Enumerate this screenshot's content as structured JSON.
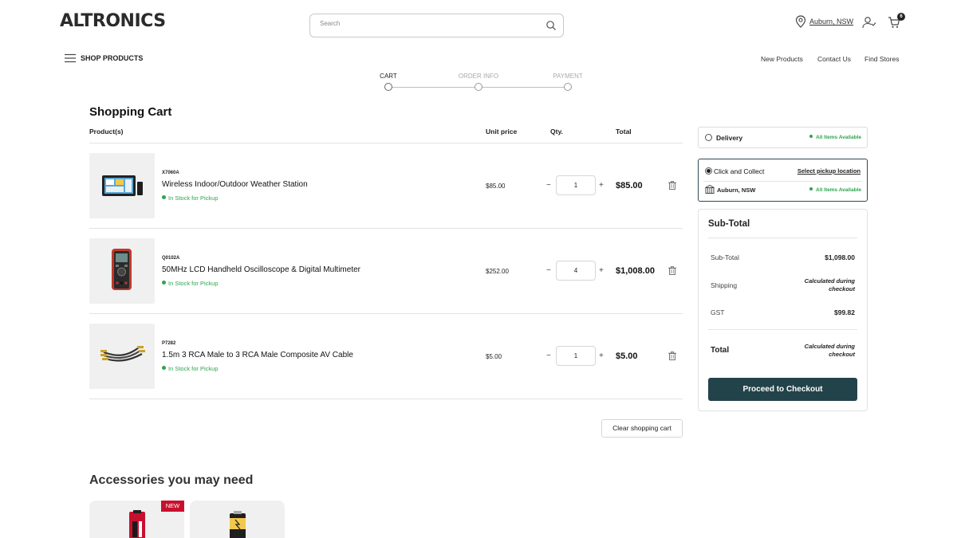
{
  "header": {
    "logo_text": "ALTRONICS",
    "search_placeholder": "Search",
    "location": "Auburn, NSW",
    "cart_count": "6",
    "shop_products": "SHOP PRODUCTS",
    "nav": [
      "New Products",
      "Contact Us",
      "Find Stores"
    ]
  },
  "steps": [
    {
      "label": "CART",
      "active": true
    },
    {
      "label": "ORDER INFO",
      "active": false
    },
    {
      "label": "PAYMENT",
      "active": false
    }
  ],
  "cart": {
    "title": "Shopping Cart",
    "columns": {
      "product": "Product(s)",
      "unit_price": "Unit price",
      "qty": "Qty.",
      "total": "Total"
    },
    "items": [
      {
        "sku": "X7060A",
        "name": "Wireless Indoor/Outdoor Weather Station",
        "stock": "In Stock for Pickup",
        "unit_price": "$85.00",
        "qty": "1",
        "total": "$85.00",
        "icon": "weather-station-image"
      },
      {
        "sku": "Q0102A",
        "name": "50MHz LCD Handheld Oscilloscope & Digital Multimeter",
        "stock": "In Stock for Pickup",
        "unit_price": "$252.00",
        "qty": "4",
        "total": "$1,008.00",
        "icon": "oscilloscope-image"
      },
      {
        "sku": "P7282",
        "name": "1.5m 3 RCA Male to 3 RCA Male Composite AV Cable",
        "stock": "In Stock for Pickup",
        "unit_price": "$5.00",
        "qty": "1",
        "total": "$5.00",
        "icon": "rca-cable-image"
      }
    ],
    "minus_glyph": "−",
    "plus_glyph": "+",
    "clear_label": "Clear shopping cart"
  },
  "accessories": {
    "title": "Accessories you may need",
    "new_badge": "NEW"
  },
  "fulfilment": {
    "delivery": {
      "label": "Delivery",
      "availability": "All Items Available",
      "selected": false
    },
    "collect": {
      "label": "Click and Collect",
      "select_location": "Select pickup location",
      "store": "Auburn, NSW",
      "availability": "All Items Available",
      "selected": true
    }
  },
  "summary": {
    "title": "Sub-Total",
    "rows": [
      {
        "label": "Sub-Total",
        "value": "$1,098.00"
      },
      {
        "label": "Shipping",
        "value_line1": "Calculated during",
        "value_line2": "checkout"
      },
      {
        "label": "GST",
        "value": "$99.82"
      }
    ],
    "total_label": "Total",
    "total_value_line1": "Calculated during",
    "total_value_line2": "checkout",
    "checkout_label": "Proceed to Checkout"
  },
  "colors": {
    "accent": "#23434a",
    "in_stock": "#2ea44f",
    "new_badge": "#c8102e"
  }
}
